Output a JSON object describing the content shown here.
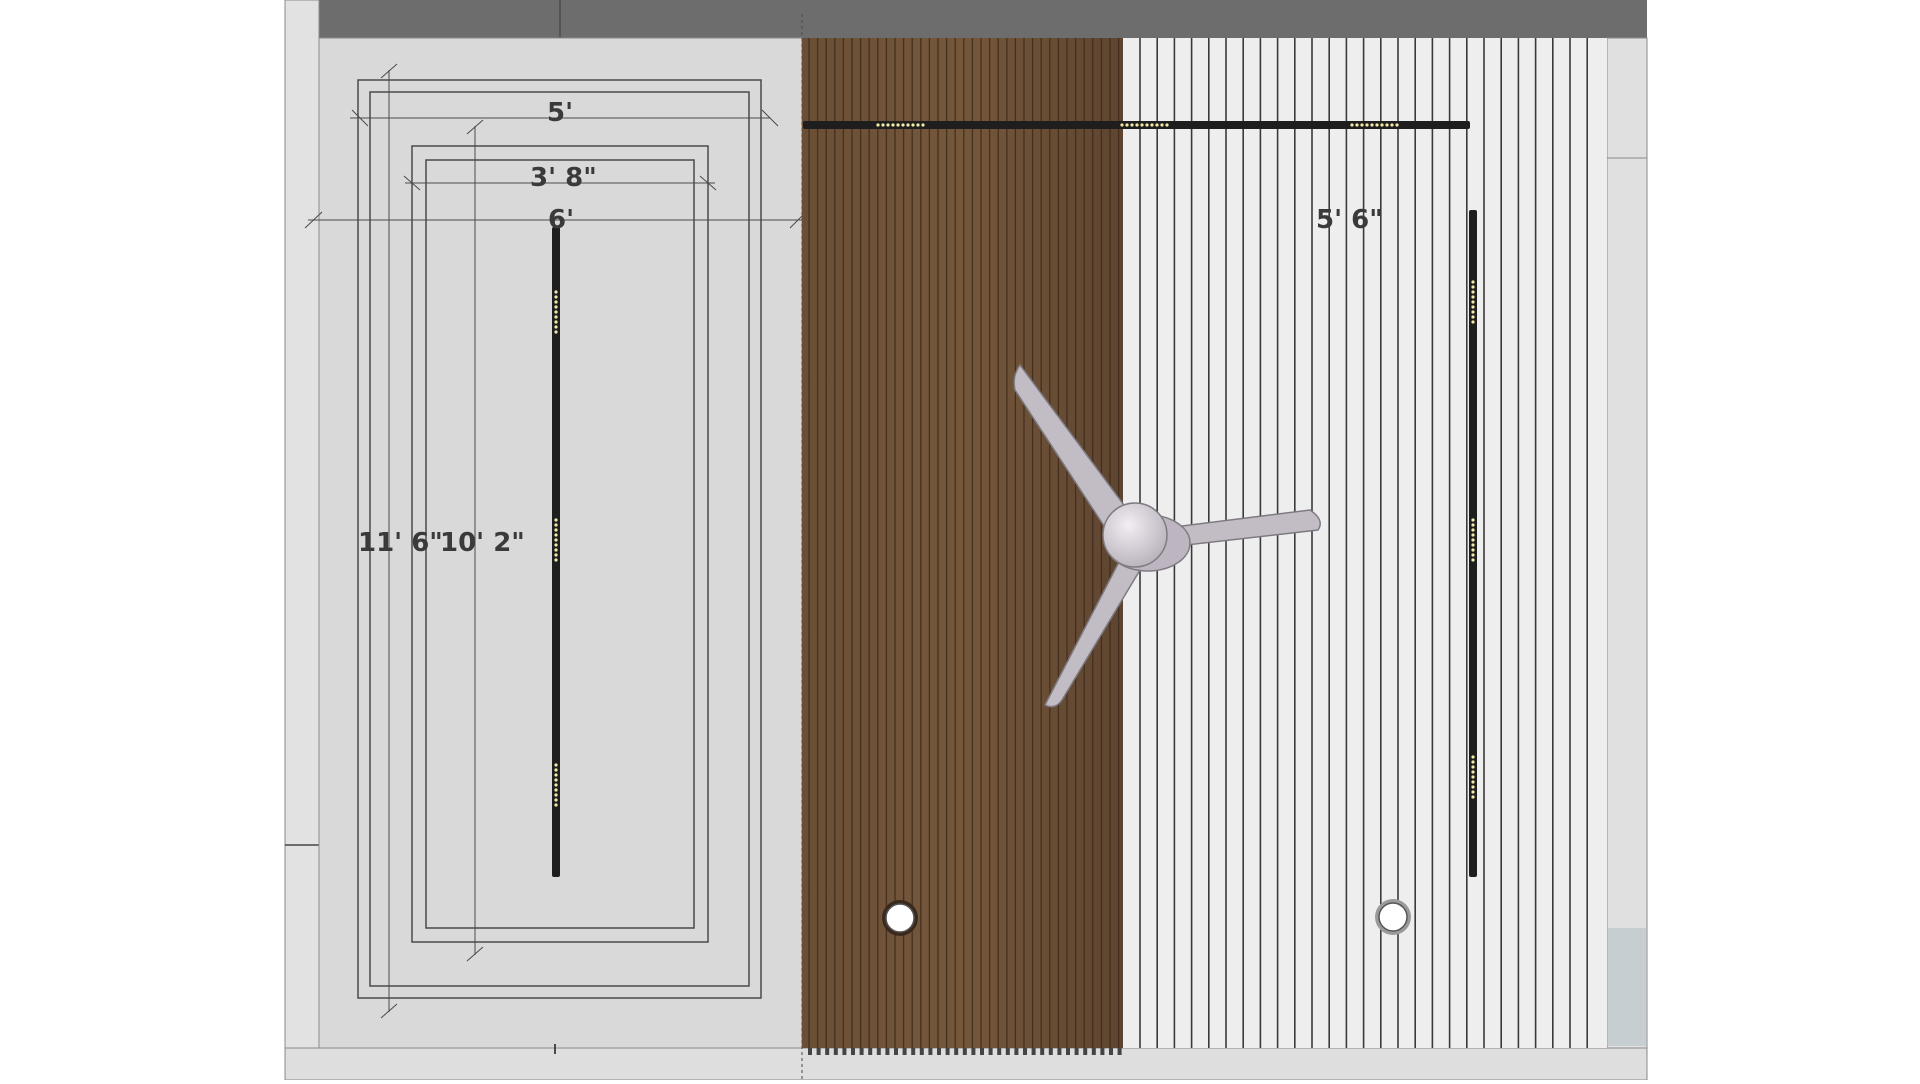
{
  "dimensions": {
    "outer_width": "5'",
    "inner_width": "3' 8\"",
    "center_width": "6'",
    "right_width": "5' 6\"",
    "outer_length": "11' 6\"",
    "inner_length": "10' 2\""
  },
  "elements": {
    "ceiling_fan": {
      "blades": 3,
      "icon": "ceiling-fan-icon"
    },
    "recessed_lights": {
      "count": 2,
      "icon": "downlight-icon"
    },
    "linear_lights": {
      "count": 3,
      "icon": "linear-light-icon"
    }
  },
  "colors": {
    "ceiling": "#d8d8d8",
    "wood_slats": "#6e5238",
    "white_slats": "#ededed",
    "beam": "#6b6b6b",
    "light_track": "#1e1e1e",
    "fan": "#c2bcc4",
    "outline": "#4a4a4a"
  }
}
